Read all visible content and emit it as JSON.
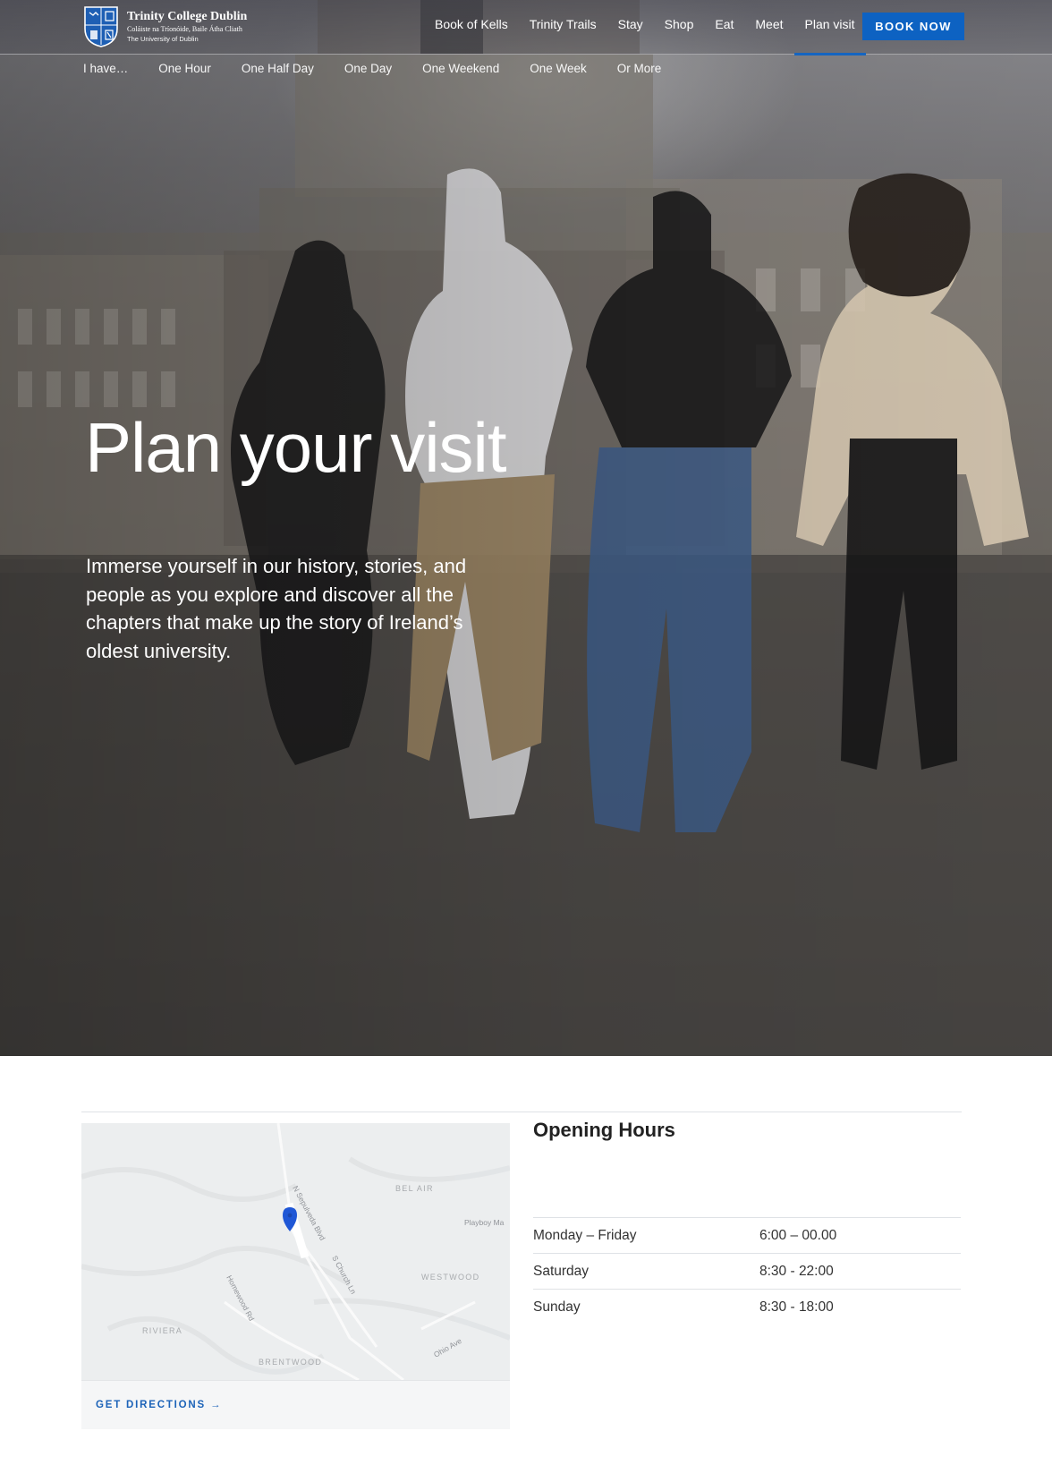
{
  "brand": {
    "title": "Trinity College Dublin",
    "subtitle_irish": "Coláiste na Tríonóide, Baile Átha Cliath",
    "subtitle_en": "The University of Dublin"
  },
  "nav": {
    "items": [
      "Book of Kells",
      "Trinity Trails",
      "Stay",
      "Shop",
      "Eat",
      "Meet",
      "Plan visit"
    ],
    "active": "Plan visit",
    "cta": "BOOK NOW"
  },
  "subnav": {
    "lead": "I have…",
    "items": [
      "One Hour",
      "One Half Day",
      "One Day",
      "One Weekend",
      "One Week",
      "Or More"
    ]
  },
  "hero": {
    "title": "Plan your visit",
    "copy": "Immerse yourself in our history, stories, and people as you explore and discover all the chapters that make up the story of Ireland’s oldest university."
  },
  "map": {
    "labels": [
      "BEL AIR",
      "WESTWOOD",
      "RIVIERA",
      "BRENTWOOD",
      "N Sepulveda Blvd",
      "S Church Ln",
      "Homewood Rd",
      "Playboy Ma",
      "Ohio Ave"
    ],
    "directions": "GET DIRECTIONS →",
    "pin_color": "#1f57d6"
  },
  "hours": {
    "title": "Opening Hours",
    "rows": [
      {
        "day": "Monday – Friday",
        "time": "6:00 – 00.00"
      },
      {
        "day": "Saturday",
        "time": "8:30 - 22:00"
      },
      {
        "day": "Sunday",
        "time": "8:30 - 18:00"
      }
    ]
  },
  "colors": {
    "accent": "#0d62c2",
    "link": "#1c63b8"
  }
}
